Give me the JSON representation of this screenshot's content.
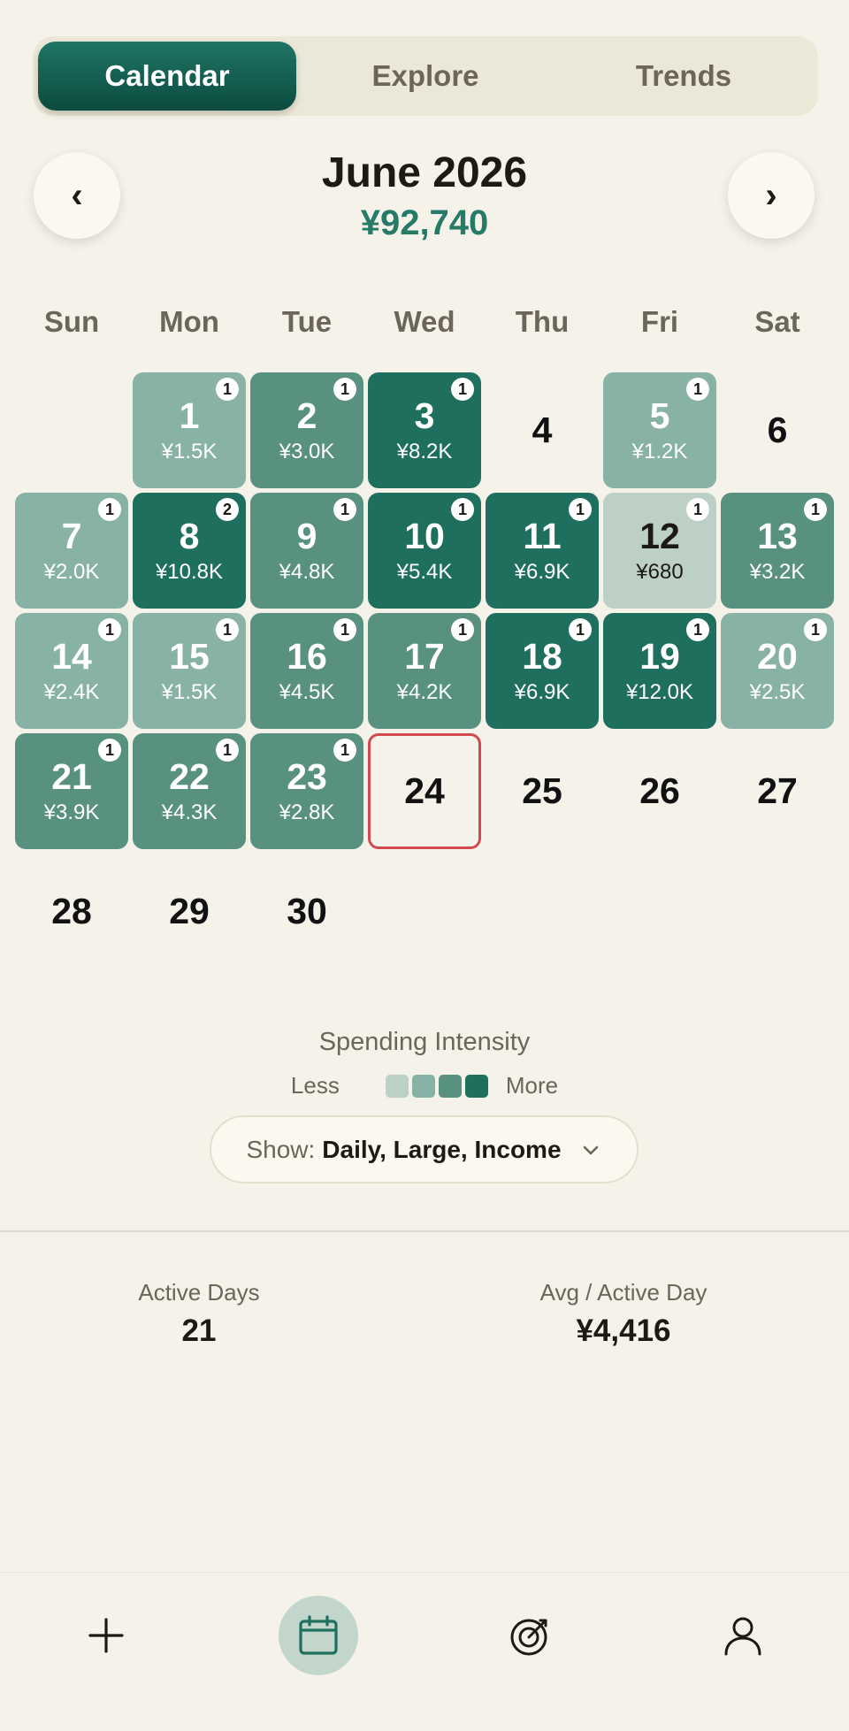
{
  "tabs": [
    {
      "label": "Calendar",
      "active": true
    },
    {
      "label": "Explore",
      "active": false
    },
    {
      "label": "Trends",
      "active": false
    }
  ],
  "header": {
    "prev": "‹",
    "next": "›",
    "title": "June 2026",
    "total": "¥92,740"
  },
  "weekdays": [
    "Sun",
    "Mon",
    "Tue",
    "Wed",
    "Thu",
    "Fri",
    "Sat"
  ],
  "first_weekday_offset": 1,
  "today": 24,
  "days": [
    {
      "day": "1",
      "amount": "¥1.5K",
      "count": "1",
      "level": 2
    },
    {
      "day": "2",
      "amount": "¥3.0K",
      "count": "1",
      "level": 3
    },
    {
      "day": "3",
      "amount": "¥8.2K",
      "count": "1",
      "level": 4
    },
    {
      "day": "4",
      "amount": "",
      "count": "",
      "level": 0
    },
    {
      "day": "5",
      "amount": "¥1.2K",
      "count": "1",
      "level": 2
    },
    {
      "day": "6",
      "amount": "",
      "count": "",
      "level": 0
    },
    {
      "day": "7",
      "amount": "¥2.0K",
      "count": "1",
      "level": 2
    },
    {
      "day": "8",
      "amount": "¥10.8K",
      "count": "2",
      "level": 4
    },
    {
      "day": "9",
      "amount": "¥4.8K",
      "count": "1",
      "level": 3
    },
    {
      "day": "10",
      "amount": "¥5.4K",
      "count": "1",
      "level": 4
    },
    {
      "day": "11",
      "amount": "¥6.9K",
      "count": "1",
      "level": 4
    },
    {
      "day": "12",
      "amount": "¥680",
      "count": "1",
      "level": 1
    },
    {
      "day": "13",
      "amount": "¥3.2K",
      "count": "1",
      "level": 3
    },
    {
      "day": "14",
      "amount": "¥2.4K",
      "count": "1",
      "level": 2
    },
    {
      "day": "15",
      "amount": "¥1.5K",
      "count": "1",
      "level": 2
    },
    {
      "day": "16",
      "amount": "¥4.5K",
      "count": "1",
      "level": 3
    },
    {
      "day": "17",
      "amount": "¥4.2K",
      "count": "1",
      "level": 3
    },
    {
      "day": "18",
      "amount": "¥6.9K",
      "count": "1",
      "level": 4
    },
    {
      "day": "19",
      "amount": "¥12.0K",
      "count": "1",
      "level": 4
    },
    {
      "day": "20",
      "amount": "¥2.5K",
      "count": "1",
      "level": 2
    },
    {
      "day": "21",
      "amount": "¥3.9K",
      "count": "1",
      "level": 3
    },
    {
      "day": "22",
      "amount": "¥4.3K",
      "count": "1",
      "level": 3
    },
    {
      "day": "23",
      "amount": "¥2.8K",
      "count": "1",
      "level": 3
    },
    {
      "day": "24",
      "amount": "",
      "count": "",
      "level": 0
    },
    {
      "day": "25",
      "amount": "",
      "count": "",
      "level": 0
    },
    {
      "day": "26",
      "amount": "",
      "count": "",
      "level": 0
    },
    {
      "day": "27",
      "amount": "",
      "count": "",
      "level": 0
    },
    {
      "day": "28",
      "amount": "",
      "count": "",
      "level": 0
    },
    {
      "day": "29",
      "amount": "",
      "count": "",
      "level": 0
    },
    {
      "day": "30",
      "amount": "",
      "count": "",
      "level": 0
    }
  ],
  "legend": {
    "title": "Spending Intensity",
    "less": "Less",
    "more": "More",
    "colors": [
      "#bdd0c6",
      "#88b2a5",
      "#58917f",
      "#1f6f5f"
    ]
  },
  "filter": {
    "label": "Show:",
    "value": "Daily, Large, Income"
  },
  "stats": {
    "active_days_label": "Active Days",
    "active_days_value": "21",
    "avg_label": "Avg / Active Day",
    "avg_value": "¥4,416"
  },
  "bottom_nav": [
    {
      "icon": "plus-icon",
      "active": false
    },
    {
      "icon": "calendar-icon",
      "active": true
    },
    {
      "icon": "target-icon",
      "active": false
    },
    {
      "icon": "user-icon",
      "active": false
    }
  ],
  "colors": {
    "accent": "#1f6f5f",
    "today_border": "#d24a4f",
    "total": "#267a68"
  }
}
